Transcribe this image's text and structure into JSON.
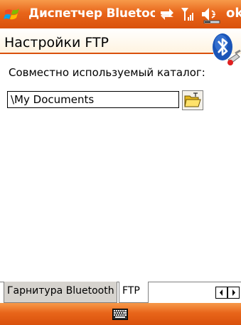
{
  "titlebar": {
    "title": "Диспетчер Bluetooth",
    "ok_label": "ok",
    "icons": [
      "windows-start-icon",
      "connectivity-icon",
      "signal-icon",
      "volume-icon"
    ]
  },
  "header": {
    "title": "Настройки FTP",
    "icon": "bluetooth-icon"
  },
  "content": {
    "shared_folder_label": "Совместно используемый каталог:",
    "folder_path": "\\My Documents",
    "browse_icon": "folder-open-icon"
  },
  "tabs": [
    {
      "label": "Гарнитура Bluetooth",
      "selected": false
    },
    {
      "label": "FTP",
      "selected": true
    }
  ],
  "menubar": {
    "icon": "keyboard-icon"
  },
  "colors": {
    "accent": "#e8651a",
    "accent_dark": "#d9510c"
  }
}
